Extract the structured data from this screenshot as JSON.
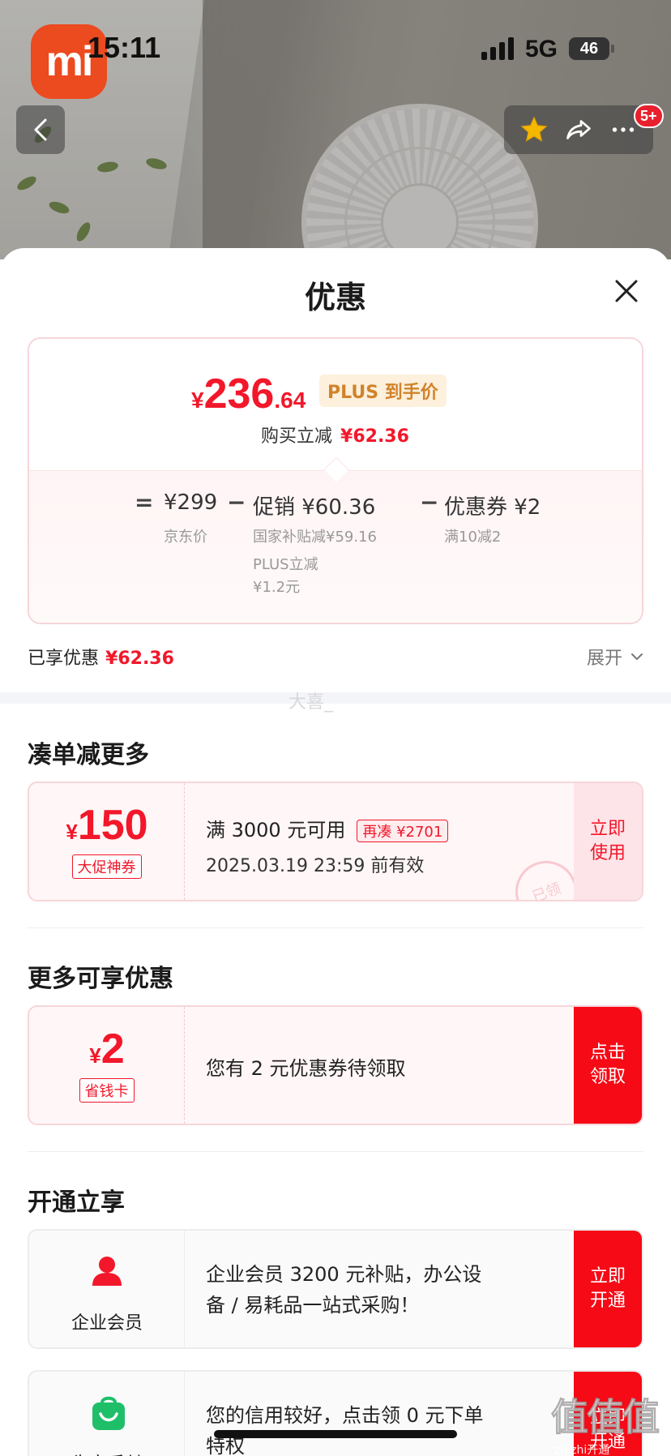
{
  "status_bar": {
    "time": "15:11",
    "network": "5G",
    "battery": "46",
    "app_logo": "mi"
  },
  "nav": {
    "badge": "5+"
  },
  "sheet": {
    "title": "优惠",
    "price": {
      "currency": "¥",
      "integer": "236",
      "decimal": ".64",
      "plus_tag": "PLUS 到手价",
      "instant_cut_label": "购买立减",
      "instant_cut_value": "¥62.36"
    },
    "breakdown": {
      "eq": "=",
      "minus": "−",
      "base": {
        "value": "¥299",
        "label": "京东价"
      },
      "promo": {
        "value": "促销 ¥60.36",
        "sub1": "国家补贴减¥59.16",
        "sub2a": "PLUS立减",
        "sub2b": "¥1.2元"
      },
      "coupon": {
        "value": "优惠券 ¥2",
        "sub": "满10减2"
      }
    },
    "saved": {
      "label": "已享优惠",
      "value": "¥62.36",
      "expand": "展开"
    },
    "watermark": "大喜_"
  },
  "sections": {
    "bundle": {
      "title": "凑单减更多",
      "coupon": {
        "currency": "¥",
        "amount": "150",
        "tag": "大促神券",
        "condition": "满 3000 元可用",
        "addon": "再凑 ¥2701",
        "expiry": "2025.03.19 23:59 前有效",
        "cta_line1": "立即",
        "cta_line2": "使用",
        "stamp": "已领"
      }
    },
    "more": {
      "title": "更多可享优惠",
      "coupon": {
        "currency": "¥",
        "amount": "2",
        "tag": "省钱卡",
        "text": "您有 2 元优惠券待领取",
        "cta_line1": "点击",
        "cta_line2": "领取"
      }
    },
    "open": {
      "title": "开通立享",
      "enterprise": {
        "label": "企业会员",
        "text_line1": "企业会员 3200 元补贴，办公设",
        "text_line2": "备 / 易耗品一站式采购！",
        "cta_line1": "立即",
        "cta_line2": "开通"
      },
      "credit": {
        "label": "先享后付",
        "text_line1": "您的信用较好，点击领 0 元下单",
        "text_line2": "特权",
        "cta_line1": "立即",
        "cta_line2": "开通"
      }
    }
  },
  "corner_watermark": {
    "big": "值值值",
    "small": "zhizhi开通"
  },
  "colors": {
    "accent": "#f2172a",
    "cta": "#f50a16",
    "plus_gold": "#d0832b",
    "green": "#1fbf6a"
  }
}
